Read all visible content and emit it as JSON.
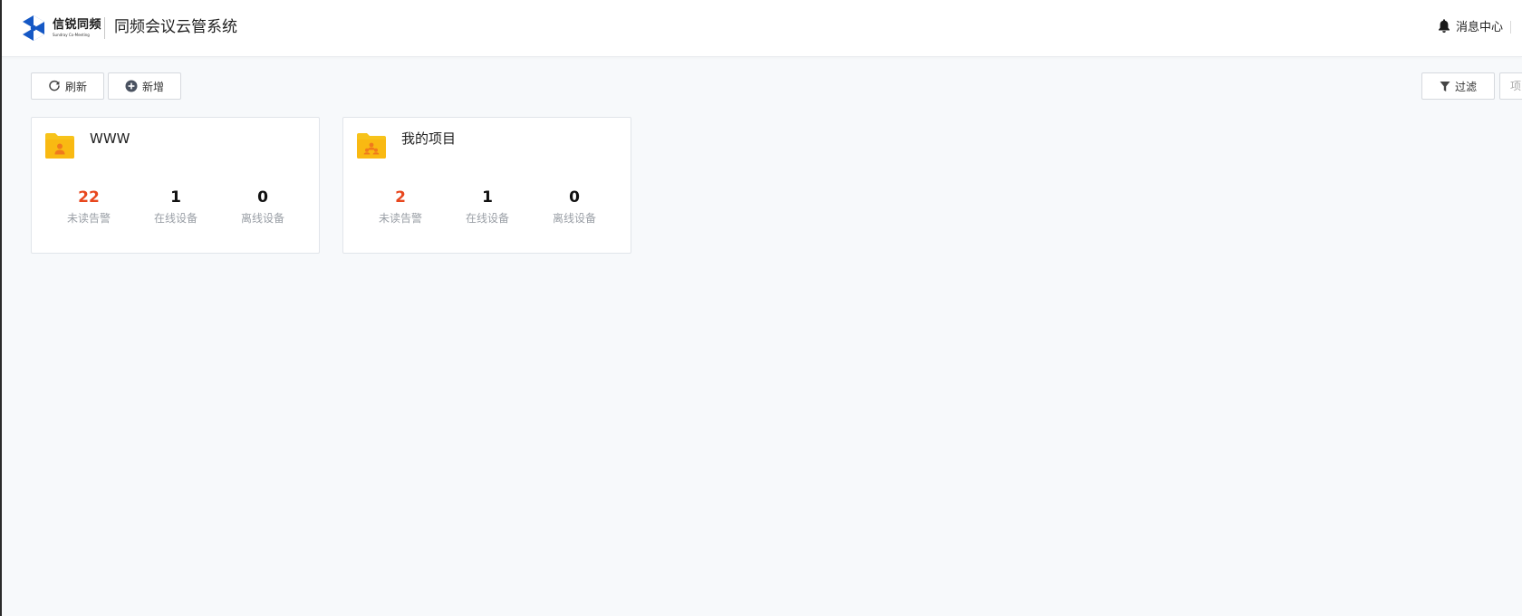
{
  "header": {
    "logo_name": "信锐同频",
    "logo_sub": "Sundray Co-Meeting",
    "system_title": "同频会议云管系统",
    "message_center": "消息中心"
  },
  "toolbar": {
    "refresh_label": "刷新",
    "add_label": "新增",
    "filter_label": "过滤",
    "partial_label": "项"
  },
  "colors": {
    "brand_blue": "#1558c5",
    "folder_yellow": "#f7c31b",
    "alert_orange": "#e8471e"
  },
  "projects": [
    {
      "title": "WWW",
      "icon": "folder-user-icon",
      "stats": [
        {
          "value": "22",
          "label": "未读告警"
        },
        {
          "value": "1",
          "label": "在线设备"
        },
        {
          "value": "0",
          "label": "离线设备"
        }
      ]
    },
    {
      "title": "我的项目",
      "icon": "folder-team-icon",
      "stats": [
        {
          "value": "2",
          "label": "未读告警"
        },
        {
          "value": "1",
          "label": "在线设备"
        },
        {
          "value": "0",
          "label": "离线设备"
        }
      ]
    }
  ]
}
